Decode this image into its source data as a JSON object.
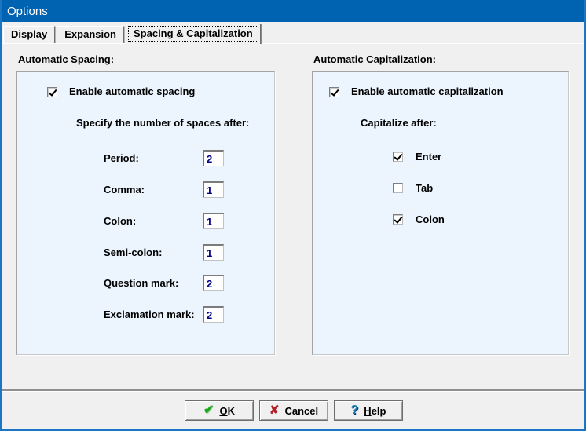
{
  "window": {
    "title": "Options"
  },
  "tabs": [
    {
      "label": "Display",
      "active": false
    },
    {
      "label": "Expansion",
      "active": false
    },
    {
      "label": "Spacing & Capitalization",
      "active": true
    }
  ],
  "spacing_group": {
    "label": {
      "pre": "Automatic ",
      "accel": "S",
      "post": "pacing:"
    },
    "enable_checkbox": {
      "label": "Enable automatic spacing",
      "checked": true
    },
    "instruction": "Specify the number of spaces after:",
    "fields": [
      {
        "label": "Period:",
        "value": "2"
      },
      {
        "label": "Comma:",
        "value": "1"
      },
      {
        "label": "Colon:",
        "value": "1"
      },
      {
        "label": "Semi-colon:",
        "value": "1"
      },
      {
        "label": "Question mark:",
        "value": "2"
      },
      {
        "label": "Exclamation mark:",
        "value": "2"
      }
    ]
  },
  "capitalization_group": {
    "label": {
      "pre": "Automatic ",
      "accel": "C",
      "post": "apitalization:"
    },
    "enable_checkbox": {
      "label": "Enable automatic capitalization",
      "checked": true
    },
    "instruction": "Capitalize after:",
    "checkboxes": [
      {
        "label": "Enter",
        "checked": true
      },
      {
        "label": "Tab",
        "checked": false
      },
      {
        "label": "Colon",
        "checked": true
      }
    ]
  },
  "buttons": {
    "ok": {
      "pre": "",
      "accel": "O",
      "post": "K"
    },
    "cancel": {
      "label": "Cancel"
    },
    "help": {
      "accel": "H",
      "post": "elp"
    }
  },
  "icons": {
    "ok_check": "✔",
    "cancel_x": "✘",
    "help_question": "?"
  },
  "colors": {
    "titlebar": "#0063B1",
    "window_border": "#1B74C4",
    "group_background": "#ECF5FE",
    "field_text": "#000080"
  }
}
